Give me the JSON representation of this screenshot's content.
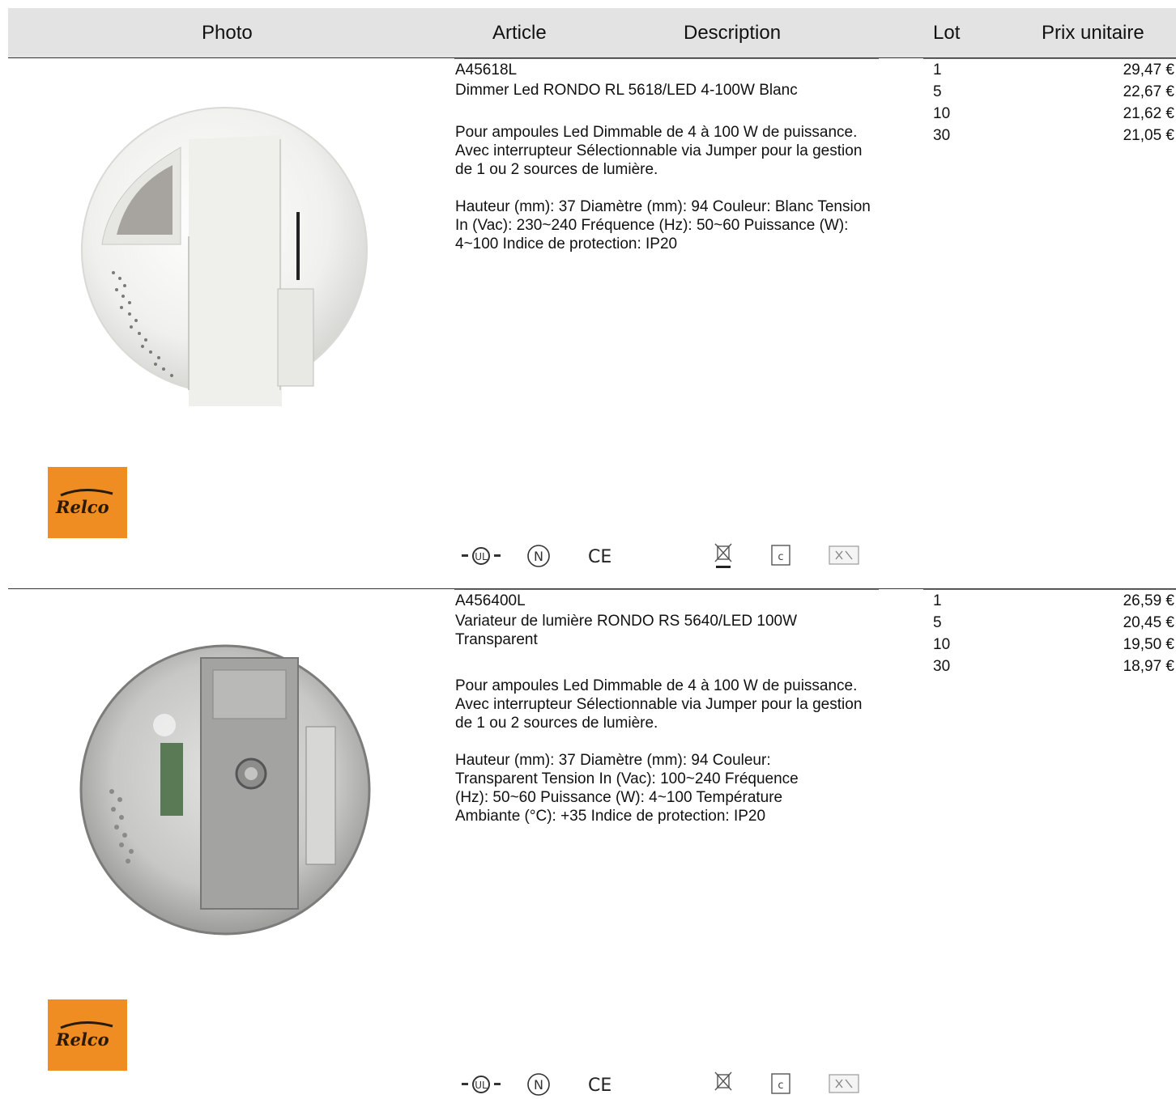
{
  "header": {
    "photo": "Photo",
    "article": "Article",
    "description": "Description",
    "lot": "Lot",
    "prix": "Prix unitaire"
  },
  "products": [
    {
      "code": "A45618L",
      "name": "Dimmer Led RONDO RL 5618/LED 4-100W Blanc",
      "desc1": "Pour ampoules Led Dimmable de 4 à 100 W de puissance. Avec interrupteur Sélectionnable via Jumper pour la gestion de 1 ou 2 sources de lumière.",
      "desc2": "Hauteur (mm): 37 Diamètre (mm): 94 Couleur: Blanc Tension In (Vac): 230~240 Fréquence (Hz): 50~60 Puissance (W): 4~100 Indice de protection: IP20",
      "lots": [
        {
          "qty": "1",
          "price": "29,47 €"
        },
        {
          "qty": "5",
          "price": "22,67 €"
        },
        {
          "qty": "10",
          "price": "21,62 €"
        },
        {
          "qty": "30",
          "price": "21,05 €"
        }
      ],
      "brand_logo": "Relco",
      "photo_color": "#f1f1ef",
      "cert_icons": [
        "ul-icon",
        "n-mark-icon",
        "ce-icon",
        "weee-bin-icon",
        "c-box-icon",
        "rohs-icon"
      ]
    },
    {
      "code": "A456400L",
      "name": "Variateur de lumière RONDO RS 5640/LED 100W Transparent",
      "desc1": "Pour ampoules Led Dimmable de 4 à 100 W de puissance. Avec interrupteur Sélectionnable via Jumper pour la gestion de 1 ou 2 sources de lumière.",
      "desc2": "Hauteur (mm): 37 Diamètre (mm): 94 Couleur: Transparent Tension In (Vac): 100~240 Fréquence (Hz): 50~60 Puissance (W): 4~100 Température Ambiante (°C): +35 Indice de protection: IP20",
      "lots": [
        {
          "qty": "1",
          "price": "26,59 €"
        },
        {
          "qty": "5",
          "price": "20,45 €"
        },
        {
          "qty": "10",
          "price": "19,50 €"
        },
        {
          "qty": "30",
          "price": "18,97 €"
        }
      ],
      "brand_logo": "Relco",
      "photo_color": "#bcbcbc",
      "cert_icons": [
        "ul-icon",
        "n-mark-icon",
        "ce-icon",
        "weee-bin-icon",
        "c-box-icon",
        "rohs-icon"
      ]
    }
  ],
  "colors": {
    "header_bg": "#e3e3e3",
    "logo_bg": "#f08d22"
  }
}
